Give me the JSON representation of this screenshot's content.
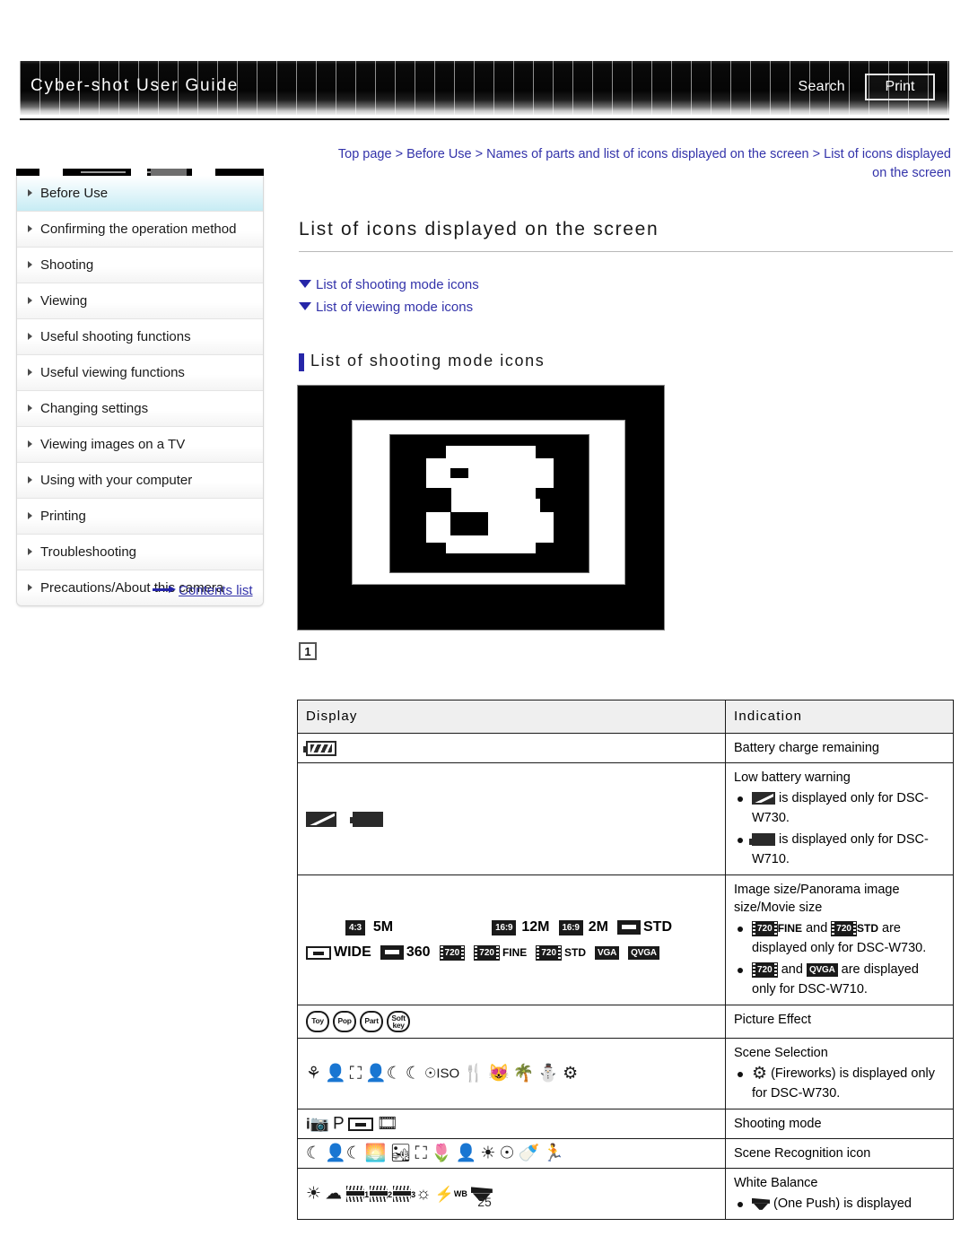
{
  "header": {
    "title": "Cyber-shot User Guide",
    "search_label": "Search",
    "print_label": "Print"
  },
  "breadcrumb": {
    "text": "Top page > Before Use > Names of parts and list of icons displayed on the screen > List of icons displayed on the screen"
  },
  "sidebar": {
    "items": [
      {
        "label": "Before Use",
        "active": true
      },
      {
        "label": "Confirming the operation method",
        "active": false
      },
      {
        "label": "Shooting",
        "active": false
      },
      {
        "label": "Viewing",
        "active": false
      },
      {
        "label": "Useful shooting functions",
        "active": false
      },
      {
        "label": "Useful viewing functions",
        "active": false
      },
      {
        "label": "Changing settings",
        "active": false
      },
      {
        "label": "Viewing images on a TV",
        "active": false
      },
      {
        "label": "Using with your computer",
        "active": false
      },
      {
        "label": "Printing",
        "active": false
      },
      {
        "label": "Troubleshooting",
        "active": false
      },
      {
        "label": "Precautions/About this camera",
        "active": false
      }
    ],
    "contents_link": "Contents list"
  },
  "main": {
    "page_title": "List of icons displayed on the screen",
    "jump_links": [
      "List of shooting mode icons",
      "List of viewing mode icons"
    ],
    "section_heading": "List of shooting mode icons",
    "figure_number": "1"
  },
  "table": {
    "headers": [
      "Display",
      "Indication"
    ],
    "rows": [
      {
        "icons": [
          "battery-full-icon"
        ],
        "indication_title": "Battery charge remaining",
        "bullets": []
      },
      {
        "icons": [
          "battery-slash-icon",
          "battery-empty-icon"
        ],
        "indication_title": "Low battery warning",
        "bullets": [
          "is displayed only for DSC-W730.",
          "is displayed only for DSC-W710."
        ]
      },
      {
        "icons": [
          "4:3 5M",
          "16:9 12M",
          "16:9 2M",
          "STD",
          "WIDE",
          "360",
          "720",
          "720 FINE",
          "720 STD",
          "VGA",
          "QVGA"
        ],
        "indication_title": "Image size/Panorama image size/Movie size",
        "bullets": [
          "and are displayed only for DSC-W730.",
          "and are displayed only for DSC-W710."
        ]
      },
      {
        "icons": [
          "Toy",
          "Pop",
          "Part",
          "Soft key"
        ],
        "indication_title": "Picture Effect",
        "bullets": []
      },
      {
        "icons": [
          "soft-skin-icon",
          "portrait-icon",
          "landscape-icon",
          "night-portrait-icon",
          "night-scene-icon",
          "high-sensitivity-icon",
          "gourmet-icon",
          "pet-icon",
          "beach-icon",
          "snow-icon",
          "fireworks-icon"
        ],
        "indication_title": "Scene Selection",
        "bullets": [
          "(Fireworks) is displayed only for DSC-W730."
        ]
      },
      {
        "icons": [
          "intelligent-auto-icon",
          "P",
          "panorama-icon",
          "movie-icon"
        ],
        "indication_title": "Shooting mode",
        "bullets": []
      },
      {
        "icons": [
          "night-scene-icon",
          "night-portrait-icon",
          "backlight-icon",
          "backlight-portrait-icon",
          "landscape-icon",
          "macro-icon",
          "portrait-icon",
          "low-light-icon",
          "tripod-icon",
          "baby-icon",
          "moving-subject-icon"
        ],
        "indication_title": "Scene Recognition icon",
        "bullets": []
      },
      {
        "icons": [
          "daylight-icon",
          "cloudy-icon",
          "fluorescent-1-icon",
          "fluorescent-2-icon",
          "fluorescent-3-icon",
          "incandescent-icon",
          "flash-wb-icon",
          "one-push-icon"
        ],
        "indication_title": "White Balance",
        "bullets": [
          "(One Push) is displayed"
        ]
      }
    ],
    "labels": {
      "size_4_3": "4:3",
      "size_5m": "5M",
      "size_16_9": "16:9",
      "size_12m": "12M",
      "size_2m": "2M",
      "std": "STD",
      "wide": "WIDE",
      "n360": "360",
      "n720": "720",
      "fine": "FINE",
      "vga": "VGA",
      "qvga": "QVGA",
      "toy": "Toy",
      "pop": "Pop",
      "part": "Part",
      "soft": "Soft",
      "key": "key",
      "p_mode": "P",
      "i_mode": "i",
      "wb_sup": "WB",
      "fl1": "1",
      "fl2": "2",
      "fl3": "3",
      "device_730": "DSC-W730.",
      "device_710": "DSC-W710.",
      "fireworks_note_a": "(Fireworks) is displayed",
      "fireworks_note_b": "only for DSC-W730.",
      "onepush_note": "(One Push) is displayed",
      "and_text": "and",
      "are_text": "are",
      "is_displayed_only_for": "is displayed only for",
      "are_displayed": "are displayed",
      "only_for": "only for",
      "displayed_only_for": "displayed only for"
    }
  },
  "footer": {
    "page_number": "25"
  }
}
